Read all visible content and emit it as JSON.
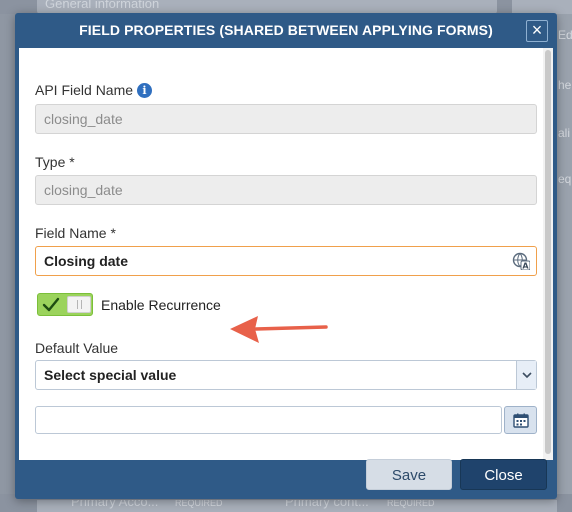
{
  "background": {
    "top_tab_text": "General information",
    "right_panel_texts": [
      "Edi",
      "her",
      "ali",
      "equ"
    ],
    "bottom_texts": [
      "Primary Acco...",
      "REQUIRED",
      "Primary cont...",
      "REQUIRED"
    ]
  },
  "modal": {
    "title": "FIELD PROPERTIES (SHARED BETWEEN APPLYING FORMS)",
    "close_icon": "×"
  },
  "form": {
    "api_field_name": {
      "label": "API Field Name",
      "value": "closing_date",
      "info_icon": "i"
    },
    "type": {
      "label": "Type *",
      "value": "closing_date"
    },
    "field_name": {
      "label": "Field Name *",
      "value": "Closing date"
    },
    "recurrence": {
      "label": "Enable Recurrence",
      "enabled": true
    },
    "default_value": {
      "label": "Default Value",
      "selected": "Select special value"
    },
    "date_value": ""
  },
  "footer": {
    "save_label": "Save",
    "close_label": "Close"
  },
  "icons": {
    "translate": "translate-icon",
    "calendar": "calendar-icon",
    "dropdown": "chevron-down-icon",
    "check": "check-icon",
    "annotation": "red-arrow"
  },
  "colors": {
    "header": "#2f5a87",
    "toggle_on": "#9bd35c",
    "active_border": "#f0a04b",
    "arrow": "#e8614a",
    "close_button": "#1f436c"
  }
}
